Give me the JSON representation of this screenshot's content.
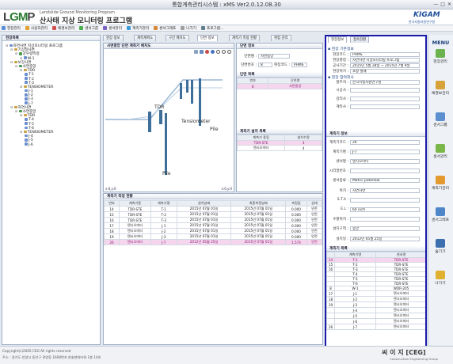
{
  "window": {
    "title": "통합계측관리시스템 : xMS Ver2.0.12.08.30",
    "buttons": [
      "—",
      "□",
      "✕"
    ]
  },
  "header": {
    "logo_l": "L",
    "logo_g": "G",
    "logo_m": "M",
    "logo_p": "P",
    "logo_sub1": "Landslide Ground Monitoring Program",
    "logo_main": "산사태 지상 모니터링 프로그램",
    "brand": "KIGAM",
    "brand_sub": "한국지질자원연구원"
  },
  "menu": [
    {
      "label": "현장관리",
      "color": "#5a8fd6"
    },
    {
      "label": "사용자관리",
      "color": "#e0a030"
    },
    {
      "label": "예경보관리",
      "color": "#d05050"
    },
    {
      "label": "센서그룹",
      "color": "#4caf50"
    },
    {
      "label": "센서관리",
      "color": "#7b61c4"
    },
    {
      "label": "계측기관리",
      "color": "#3a9ad9"
    },
    {
      "label": "센서그래프",
      "color": "#d9883a"
    },
    {
      "label": "나가기",
      "color": "#9e9e9e"
    },
    {
      "label": "프로그램...",
      "color": "#607d8b"
    }
  ],
  "left_panel": {
    "title": "현장목록",
    "tree": [
      {
        "indent": 0,
        "label": "자연사면 지상모니터링 프로그램",
        "color": "#6a8fcf"
      },
      {
        "indent": 1,
        "label": "기상청사면",
        "color": "#c8a040"
      },
      {
        "indent": 2,
        "label": "강우량측정",
        "color": "#4a9a4a"
      },
      {
        "indent": 3,
        "label": "W-1",
        "color": "#6a8fcf"
      },
      {
        "indent": 1,
        "label": "보강사면",
        "color": "#c8a040"
      },
      {
        "indent": 2,
        "label": "사면중앙",
        "color": "#4a9a4a"
      },
      {
        "indent": 3,
        "label": "TDR",
        "color": "#c8a040"
      },
      {
        "indent": 4,
        "label": "T-1",
        "color": "#6a8fcf"
      },
      {
        "indent": 4,
        "label": "T-2",
        "color": "#6a8fcf"
      },
      {
        "indent": 4,
        "label": "T-3",
        "color": "#6a8fcf"
      },
      {
        "indent": 3,
        "label": "TENSIOMETER",
        "color": "#c8a040"
      },
      {
        "indent": 4,
        "label": "J-1",
        "color": "#6a8fcf"
      },
      {
        "indent": 4,
        "label": "J-2",
        "color": "#6a8fcf"
      },
      {
        "indent": 4,
        "label": "J-3",
        "color": "#6a8fcf"
      },
      {
        "indent": 4,
        "label": "J-7",
        "color": "#6a8fcf"
      },
      {
        "indent": 1,
        "label": "자연사면",
        "color": "#c8a040"
      },
      {
        "indent": 2,
        "label": "사면중앙",
        "color": "#4a9a4a"
      },
      {
        "indent": 3,
        "label": "TDR",
        "color": "#c8a040"
      },
      {
        "indent": 4,
        "label": "T-4",
        "color": "#6a8fcf"
      },
      {
        "indent": 4,
        "label": "T-5",
        "color": "#6a8fcf"
      },
      {
        "indent": 4,
        "label": "T-6",
        "color": "#6a8fcf"
      },
      {
        "indent": 3,
        "label": "TENSIOMETER",
        "color": "#c8a040"
      },
      {
        "indent": 4,
        "label": "J-4",
        "color": "#6a8fcf"
      },
      {
        "indent": 4,
        "label": "J-5",
        "color": "#6a8fcf"
      },
      {
        "indent": 4,
        "label": "J-6",
        "color": "#6a8fcf"
      }
    ]
  },
  "center_tabs": [
    "현장 정보",
    "계측계획도",
    "구간 배치도",
    "단면 정보",
    "계측기 측정 현황",
    "위험 관리"
  ],
  "diagram": {
    "title": "사면중앙 단면 계측기 배치도",
    "labels": {
      "tdr": "TDR",
      "tensiometer": "Tensiometer",
      "pile1": "Pile",
      "pile2": "Pile"
    },
    "coord_left": "x:0,y:0",
    "coord_right": "x:0,y:0"
  },
  "section_info": {
    "title": "단면 정보",
    "name_label": "단면명 :",
    "name_value": "사면중앙",
    "code_label": "단면번호 :",
    "code_value": "8",
    "site_label": "현장코드 :",
    "site_value": "PHMS"
  },
  "section_list": {
    "title": "단면 목록",
    "headers": [
      "번호",
      "단면명"
    ],
    "rows": [
      [
        "8",
        "사면중앙"
      ]
    ]
  },
  "sensor_count": {
    "title": "계측기 설치 목록",
    "headers": [
      "계측기 종류",
      "설치수량"
    ],
    "rows": [
      [
        "TDR-STE",
        "3"
      ],
      [
        "텐시오미터",
        "4"
      ]
    ]
  },
  "measure": {
    "title": "계측기 측정 현황",
    "headers": [
      "번호",
      "계측기종",
      "계측기명",
      "설치날짜",
      "최종측정날짜",
      "측정값",
      "상태"
    ],
    "rows": [
      [
        "14",
        "TDR-STE",
        "T-1",
        "2015년 07월 01일",
        "2015년 07월 01일",
        "0.000",
        "안전"
      ],
      [
        "15",
        "TDR-STE",
        "T-2",
        "2015년 07월 01일",
        "2015년 07월 01일",
        "0.000",
        "안전"
      ],
      [
        "16",
        "TDR-STE",
        "T-3",
        "2015년 07월 01일",
        "2015년 07월 01일",
        "0.000",
        "안전"
      ],
      [
        "17",
        "텐시오미터",
        "J-1",
        "2015년 07월 01일",
        "2015년 07월 01일",
        "0.000",
        "안전"
      ],
      [
        "18",
        "텐시오미터",
        "J-2",
        "2015년 07월 01일",
        "2015년 07월 01일",
        "0.000",
        "안전"
      ],
      [
        "19",
        "텐시오미터",
        "J-3",
        "2015년 07월 01일",
        "2015년 07월 01일",
        "0.000",
        "안전"
      ],
      [
        "26",
        "텐시오미터",
        "J-7",
        "2012년 05월 25일",
        "2015년 07월 01일",
        "1.574",
        "안전"
      ]
    ]
  },
  "right_panel": {
    "tabs": [
      "현장정보",
      "접속현황"
    ],
    "basic_title": "현장 기본정보",
    "basic": [
      [
        "현장코드 :",
        "PHMS"
      ],
      [
        "현장명칭 :",
        "자연사면 지상모니터링 프로그램"
      ],
      [
        "공사기간 :",
        "2015년 5월 28일 ~ 2015년 7월 9일"
      ],
      [
        "현장위치 :",
        "포항 철재"
      ]
    ],
    "org_title": "현장 참여회사",
    "org": [
      [
        "발주처 :",
        "한국지질자원연구원"
      ],
      [
        "시공사 :",
        ""
      ],
      [
        "감리사 :",
        ""
      ],
      [
        "계측사 :",
        ""
      ]
    ],
    "sensor_title": "계측기 정보",
    "sensor": [
      [
        "계측기코드 :",
        "26"
      ],
      [
        "계측기명 :",
        "J-7"
      ],
      [
        "센서명 :",
        "텐시오미터"
      ],
      [
        "시리얼번호 :",
        ""
      ],
      [
        "센서종류 :",
        "Matric potential"
      ],
      [
        "위치 :",
        "자연사면"
      ],
      [
        "S.T.A :",
        ""
      ],
      [
        "E.L :",
        "60 inch"
      ],
      [
        "수평위치 :",
        ""
      ],
      [
        "설치구역 :",
        "중앙"
      ],
      [
        "설치일 :",
        "2012년 05월 25일"
      ]
    ],
    "list_title": "계측기 목록",
    "list_headers": [
      "계측기명",
      "센서명"
    ],
    "list_rows": [
      [
        "T-1",
        "TDR-STE"
      ],
      [
        "T-2",
        "TDR-STE"
      ],
      [
        "T-3",
        "TDR-STE"
      ],
      [
        "T-4",
        "TDR-STE"
      ],
      [
        "T-5",
        "TDR-STE"
      ],
      [
        "T-6",
        "TDR-STE"
      ],
      [
        "W-1",
        "WDR-205"
      ],
      [
        "J-1",
        "텐시오미터"
      ],
      [
        "J-2",
        "텐시오미터"
      ],
      [
        "J-3",
        "텐시오미터"
      ],
      [
        "J-4",
        "텐시오미터"
      ],
      [
        "J-5",
        "텐시오미터"
      ],
      [
        "J-6",
        "텐시오미터"
      ],
      [
        "J-7",
        "텐시오미터"
      ]
    ],
    "list_numbers": [
      "14",
      "15",
      "16",
      "",
      "",
      "",
      "8",
      "17",
      "18",
      "19",
      "",
      "",
      "",
      "26"
    ]
  },
  "side_menu": {
    "title": "MENU",
    "items": [
      {
        "label": "현장관리",
        "color": "#6cb24f"
      },
      {
        "label": "예경보관리",
        "color": "#d8a23a"
      },
      {
        "label": "센서그룹",
        "color": "#5b8fcf"
      },
      {
        "label": "센서관리",
        "color": "#7ab648"
      },
      {
        "label": "계측기관리",
        "color": "#e59a2f"
      },
      {
        "label": "센서그래프",
        "color": "#4e86c8"
      },
      {
        "label": "숨기기",
        "color": "#3c6fb0"
      },
      {
        "label": "나가기",
        "color": "#e0b030"
      }
    ]
  },
  "status": {
    "copyright": "Copyright(c)2005 CEG All rights reserved",
    "address": "주소 : 경기도 안양시 동안구 관양동 1608번지 한솔벤처타워 1층 14호",
    "brand": "씨 이 지 [CEG]",
    "brand_sub": "Construction Engineering Group"
  }
}
